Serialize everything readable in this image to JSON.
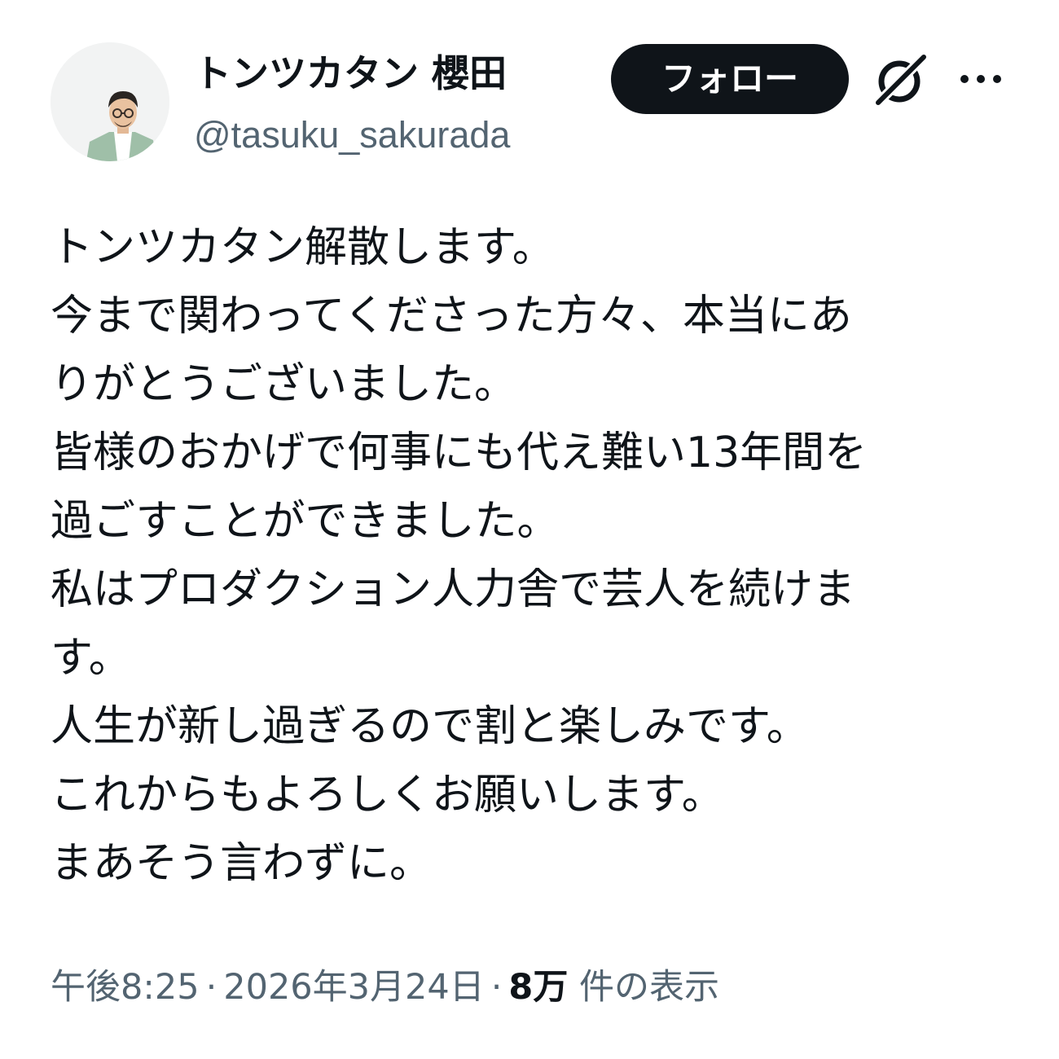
{
  "author": {
    "display_name": "トンツカタン 櫻田",
    "handle": "@tasuku_sakurada",
    "avatar_icon": "user-avatar-photo"
  },
  "actions": {
    "follow_label": "フォロー",
    "grok_icon": "grok-icon",
    "more_icon": "more-options-icon"
  },
  "post": {
    "lines": [
      "トンツカタン解散します。",
      "今まで関わってくださった方々、本当にあ",
      "りがとうございました。",
      "皆様のおかげで何事にも代え難い13年間を",
      "過ごすことができました。",
      "私はプロダクション人力舎で芸人を続けま",
      "す。",
      "人生が新し過ぎるので割と楽しみです。",
      "これからもよろしくお願いします。",
      "まあそう言わずに。"
    ]
  },
  "meta": {
    "time": "午後8:25",
    "separator": "·",
    "date": "2026年3月24日",
    "views_count": "8万",
    "views_label": "件の表示"
  },
  "colors": {
    "text_primary": "#0f1419",
    "text_secondary": "#536471",
    "button_bg": "#0f1419",
    "button_text": "#ffffff",
    "background": "#ffffff"
  }
}
